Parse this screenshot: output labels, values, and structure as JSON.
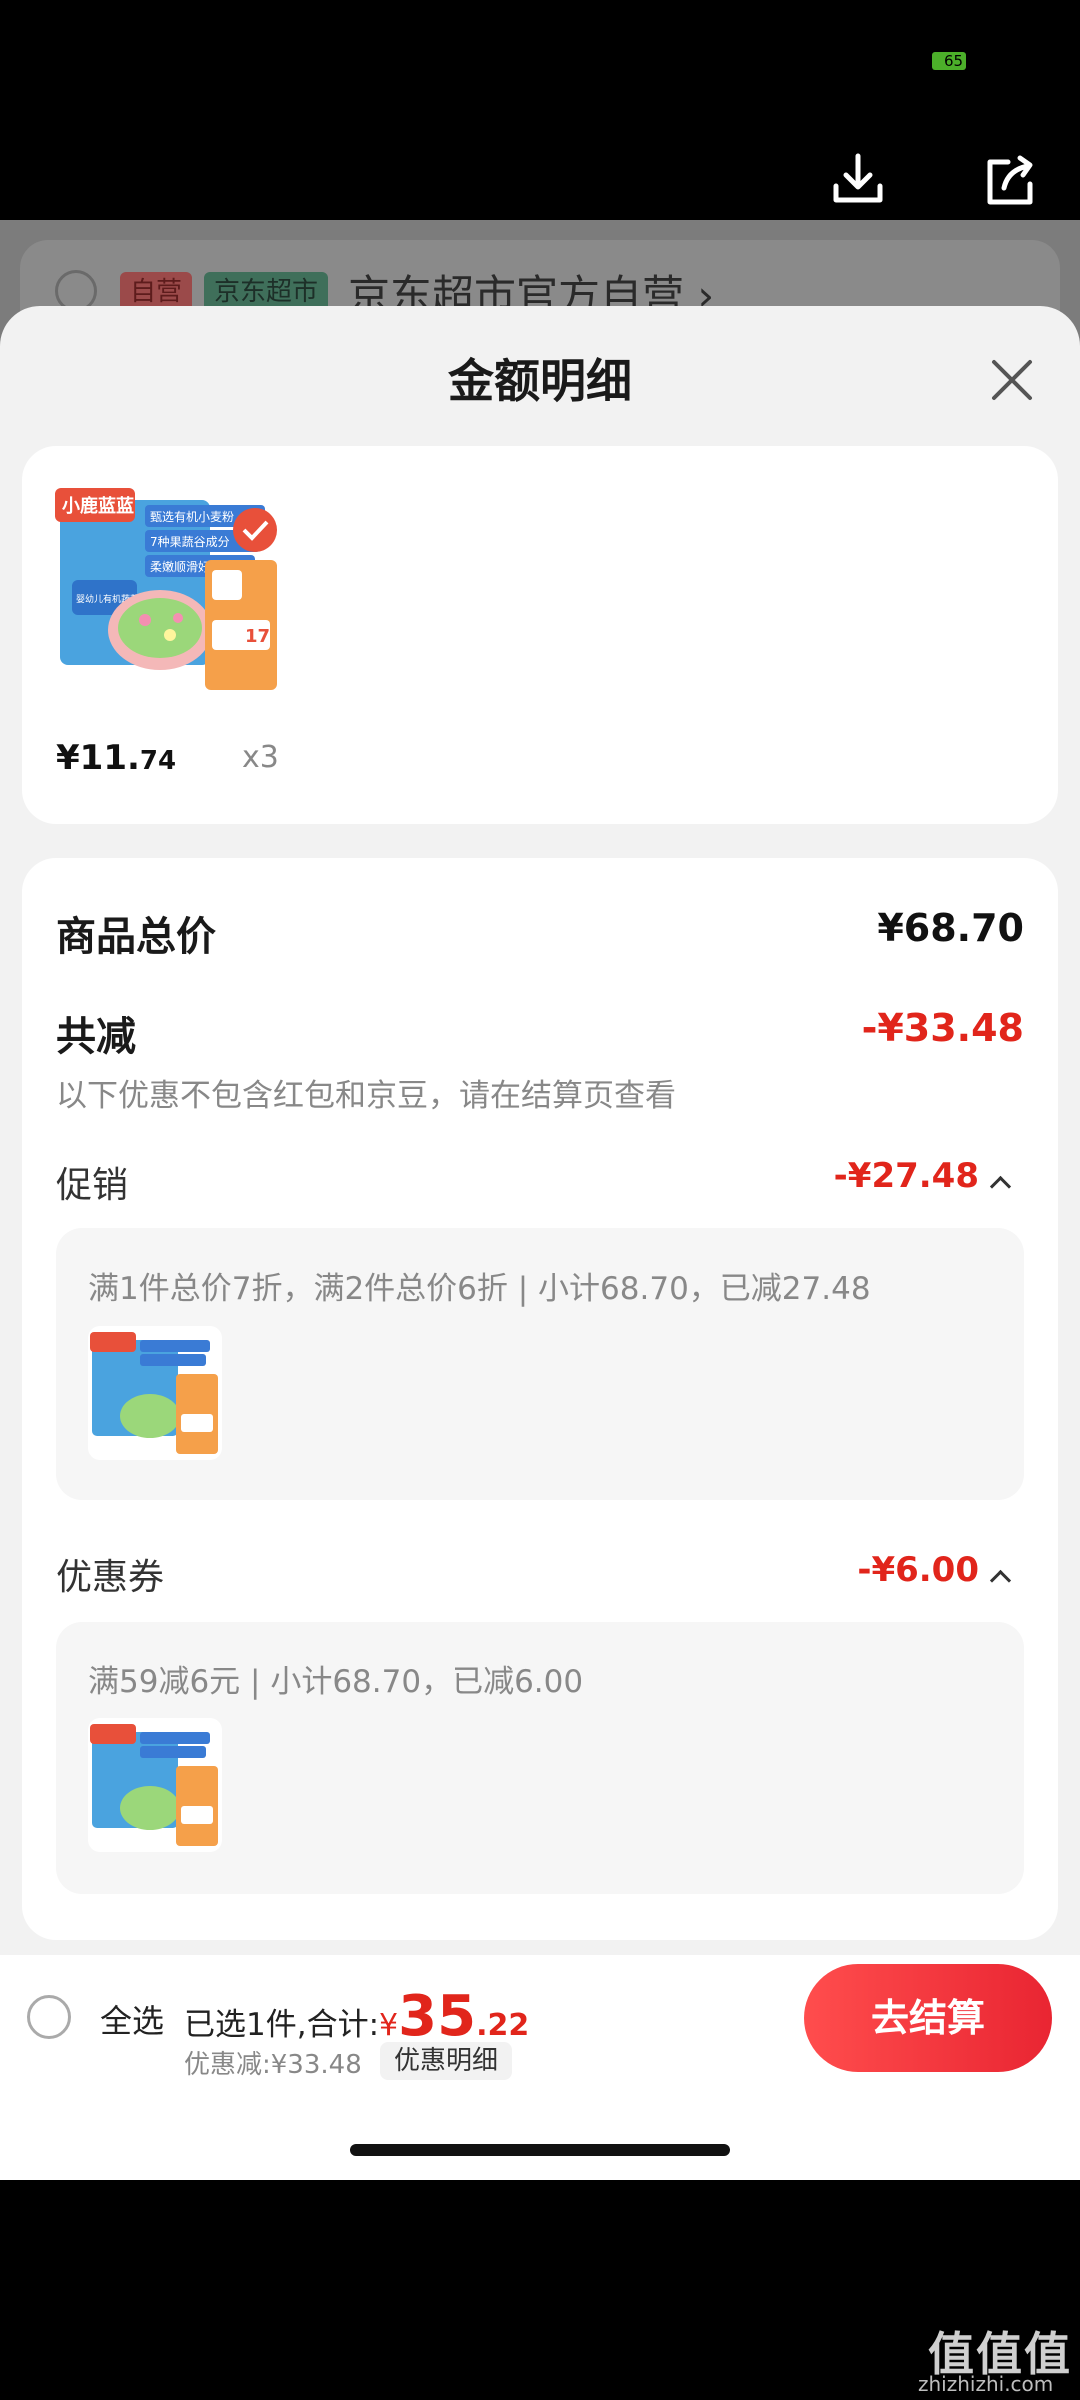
{
  "status_bar": {
    "battery": "65"
  },
  "background_page": {
    "tags": [
      "自营",
      "京东超市"
    ],
    "shop_name": "京东超市官方自营 ›"
  },
  "sheet": {
    "title": "金额明细",
    "product": {
      "brand": "小鹿蓝蓝",
      "price_int": "¥11.",
      "price_dec": "74",
      "quantity": "x3",
      "image_texts": [
        "甄选有机小麦粉",
        "7种果蔬谷成分",
        "柔嫩顺滑好口感",
        "婴幼儿有机蔬菜多维颗粒面",
        "17"
      ]
    },
    "total": {
      "label": "商品总价",
      "value": "¥68.70"
    },
    "reduction": {
      "label": "共减",
      "value": "-¥33.48",
      "note": "以下优惠不包含红包和京豆，请在结算页查看"
    },
    "promotion": {
      "label": "促销",
      "value": "-¥27.48",
      "desc": "满1件总价7折，满2件总价6折 | 小计68.70，已减27.48"
    },
    "coupon": {
      "label": "优惠券",
      "value": "-¥6.00",
      "desc": "满59减6元 | 小计68.70，已减6.00"
    }
  },
  "bottom_bar": {
    "select_all": "全选",
    "selected_text": "已选1件,合计:",
    "total_symbol": "¥",
    "total_int": "35",
    "total_dec": ".22",
    "discount_text": "优惠减:¥33.48",
    "detail_label": "优惠明细",
    "checkout_label": "去结算"
  },
  "watermark": {
    "text": "值值值",
    "url": "zhizhizhi.com"
  },
  "colors": {
    "accent_red": "#e1251b",
    "checkout_gradient_start": "#ff4d4d",
    "checkout_gradient_end": "#e92532"
  }
}
